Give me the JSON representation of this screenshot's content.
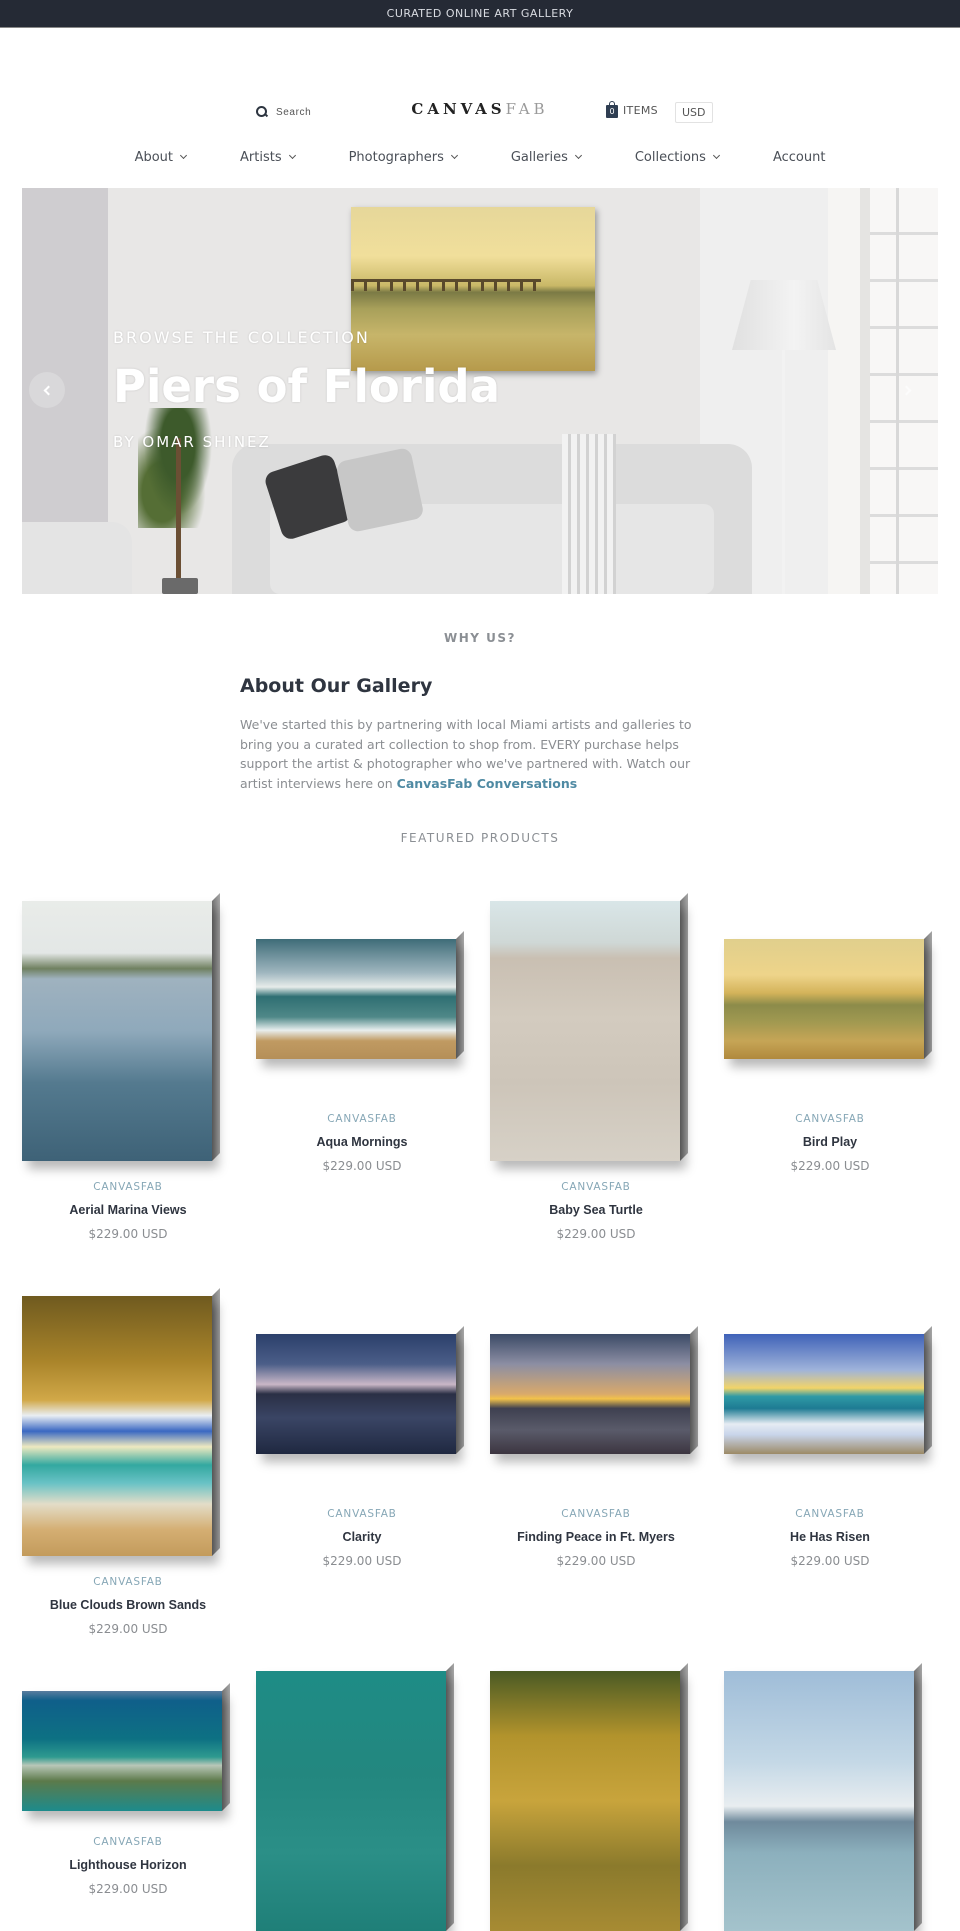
{
  "announcement": "CURATED ONLINE ART GALLERY",
  "header": {
    "search_label": "Search",
    "logo_primary": "CANVAS",
    "logo_secondary": "FAB",
    "cart_count": "0",
    "cart_label": "ITEMS",
    "currency": "USD"
  },
  "nav": [
    {
      "label": "About",
      "dropdown": true
    },
    {
      "label": "Artists",
      "dropdown": true
    },
    {
      "label": "Photographers",
      "dropdown": true
    },
    {
      "label": "Galleries",
      "dropdown": true
    },
    {
      "label": "Collections",
      "dropdown": true
    },
    {
      "label": "Account",
      "dropdown": false
    }
  ],
  "hero": {
    "eyebrow": "BROWSE THE COLLECTION",
    "title": "Piers of Florida",
    "byline": "BY OMAR SHINEZ",
    "prev_icon": "chevron-left-icon",
    "next_icon": "chevron-right-icon"
  },
  "about": {
    "eyebrow": "WHY US?",
    "heading": "About Our Gallery",
    "body": "We've started this by partnering with local Miami artists and galleries to bring you a curated art collection to shop from. EVERY purchase helps support the artist & photographer who we've partnered with. Watch our artist interviews here on ",
    "link_text": "CanvasFab Conversations"
  },
  "featured": {
    "heading": "FEATURED PRODUCTS",
    "products": [
      {
        "vendor": "CANVASFAB",
        "name": "Aerial Marina Views",
        "price": "$229.00 USD"
      },
      {
        "vendor": "CANVASFAB",
        "name": "Aqua Mornings",
        "price": "$229.00 USD"
      },
      {
        "vendor": "CANVASFAB",
        "name": "Baby Sea Turtle",
        "price": "$229.00 USD"
      },
      {
        "vendor": "CANVASFAB",
        "name": "Bird Play",
        "price": "$229.00 USD"
      },
      {
        "vendor": "CANVASFAB",
        "name": "Blue Clouds Brown Sands",
        "price": "$229.00 USD"
      },
      {
        "vendor": "CANVASFAB",
        "name": "Clarity",
        "price": "$229.00 USD"
      },
      {
        "vendor": "CANVASFAB",
        "name": "Finding Peace in Ft. Myers",
        "price": "$229.00 USD"
      },
      {
        "vendor": "CANVASFAB",
        "name": "He Has Risen",
        "price": "$229.00 USD"
      },
      {
        "vendor": "CANVASFAB",
        "name": "Lighthouse Horizon",
        "price": "$229.00 USD"
      },
      {
        "vendor": "",
        "name": "",
        "price": ""
      },
      {
        "vendor": "",
        "name": "",
        "price": ""
      },
      {
        "vendor": "",
        "name": "",
        "price": ""
      }
    ]
  },
  "colors": {
    "announcement_bg": "#252a35",
    "link": "#4f8aa3",
    "vendor": "#86a7b6",
    "heading": "#2f3540"
  }
}
